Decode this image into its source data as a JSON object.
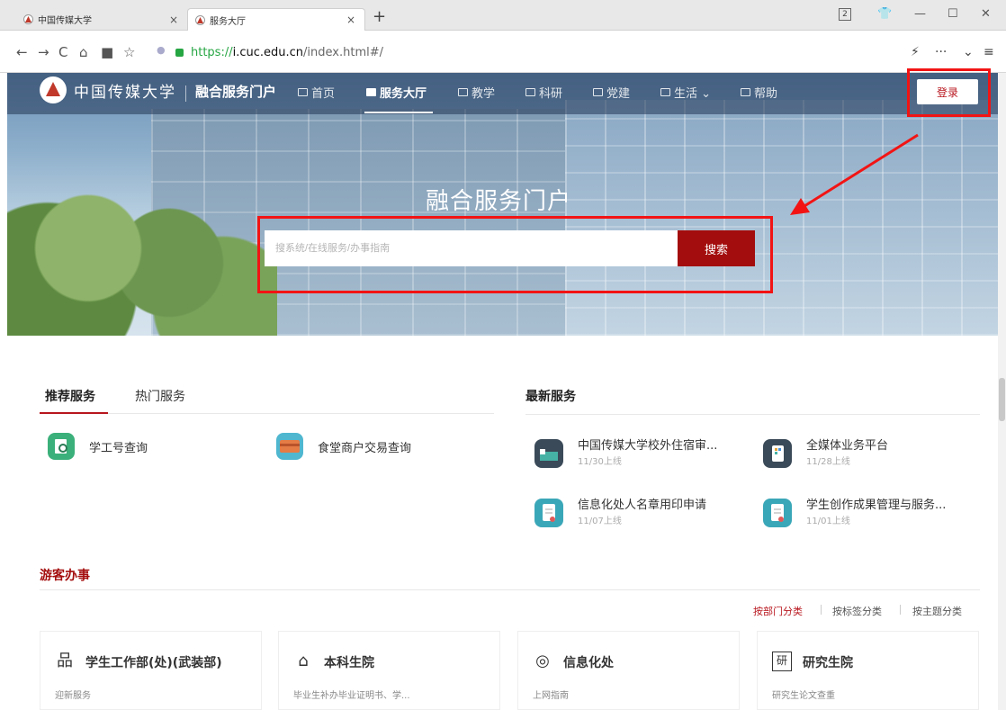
{
  "browser": {
    "tabs": [
      {
        "label": "中国传媒大学",
        "active": false
      },
      {
        "label": "服务大厅",
        "active": true
      }
    ],
    "new_tab": "+",
    "window_badge": "2",
    "url": {
      "scheme": "https://",
      "host": "i.cuc.edu.cn",
      "path": "/index.html#/"
    }
  },
  "site": {
    "logo_text": "中国传媒大学",
    "portal_title": "融合服务门户",
    "nav": [
      {
        "label": "首页",
        "active": false
      },
      {
        "label": "服务大厅",
        "active": true
      },
      {
        "label": "教学",
        "active": false
      },
      {
        "label": "科研",
        "active": false
      },
      {
        "label": "党建",
        "active": false
      },
      {
        "label": "生活 ⌄",
        "active": false
      },
      {
        "label": "帮助",
        "active": false
      }
    ],
    "login_label": "登录",
    "hero_title": "融合服务门户",
    "search": {
      "placeholder": "搜系统/在线服务/办事指南",
      "button": "搜索"
    }
  },
  "recommend": {
    "tabs": [
      "推荐服务",
      "热门服务"
    ],
    "items": [
      {
        "label": "学工号查询",
        "icon": "search-id-icon",
        "color": "#3bb07a"
      },
      {
        "label": "食堂商户交易查询",
        "icon": "card-icon",
        "color": "#e57b45"
      }
    ]
  },
  "newest": {
    "title": "最新服务",
    "items": [
      {
        "name": "中国传媒大学校外住宿审...",
        "date": "11/30上线",
        "color": "#3b4a58"
      },
      {
        "name": "全媒体业务平台",
        "date": "11/28上线",
        "color": "#3b4a58"
      },
      {
        "name": "信息化处人名章用印申请",
        "date": "11/07上线",
        "color": "#3aa7b8"
      },
      {
        "name": "学生创作成果管理与服务...",
        "date": "11/01上线",
        "color": "#3aa7b8"
      }
    ]
  },
  "guest": {
    "title": "游客办事",
    "filters": [
      {
        "label": "按部门分类",
        "active": true
      },
      {
        "label": "按标签分类",
        "active": false
      },
      {
        "label": "按主题分类",
        "active": false
      }
    ],
    "depts": [
      {
        "name": "学生工作部(处)(武装部)",
        "desc": "迎新服务",
        "icon": "org-chart-icon",
        "glyph": "品"
      },
      {
        "name": "本科生院",
        "desc": "毕业生补办毕业证明书、学...",
        "icon": "graduation-icon",
        "glyph": "⌂"
      },
      {
        "name": "信息化处",
        "desc": "上网指南",
        "icon": "globe-icon",
        "glyph": "◎"
      },
      {
        "name": "研究生院",
        "desc": "研究生论文查重",
        "icon": "research-icon",
        "glyph": "研"
      }
    ]
  },
  "colors": {
    "brand_red": "#a40d0d",
    "annotation_red": "#f21414"
  }
}
